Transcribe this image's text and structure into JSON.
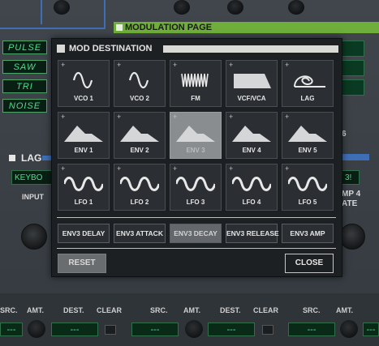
{
  "background": {
    "modulation_header": "MODULATION PAGE",
    "lfo_waves": [
      "PULSE",
      "SAW",
      "TRI",
      "NOISE"
    ],
    "lag_header": "LAG",
    "lag_field": "KEYBO",
    "lag_input_label": "INPUT",
    "right_partial_labels": [
      "6",
      "MP 4",
      "ATE"
    ],
    "right_partial_field": "3!",
    "bottom_labels": [
      "SRC.",
      "AMT.",
      "DEST.",
      "CLEAR",
      "SRC.",
      "AMT.",
      "DEST.",
      "CLEAR",
      "SRC.",
      "AMT."
    ],
    "bottom_fields": [
      "---",
      "---",
      "---",
      "---",
      "---",
      "---"
    ]
  },
  "modal": {
    "title": "MOD DESTINATION",
    "tiles": [
      {
        "label": "VCO 1",
        "icon": "sine-wave-icon"
      },
      {
        "label": "VCO 2",
        "icon": "sine-wave-icon"
      },
      {
        "label": "FM",
        "icon": "fm-wave-icon"
      },
      {
        "label": "VCF/VCA",
        "icon": "filter-shape-icon"
      },
      {
        "label": "LAG",
        "icon": "lag-curve-icon"
      },
      {
        "label": "ENV 1",
        "icon": "envelope-icon"
      },
      {
        "label": "ENV 2",
        "icon": "envelope-icon"
      },
      {
        "label": "ENV 3",
        "icon": "envelope-icon"
      },
      {
        "label": "ENV 4",
        "icon": "envelope-icon"
      },
      {
        "label": "ENV 5",
        "icon": "envelope-icon"
      },
      {
        "label": "LFO 1",
        "icon": "lfo-wave-icon"
      },
      {
        "label": "LFO 2",
        "icon": "lfo-wave-icon"
      },
      {
        "label": "LFO 3",
        "icon": "lfo-wave-icon"
      },
      {
        "label": "LFO 4",
        "icon": "lfo-wave-icon"
      },
      {
        "label": "LFO 5",
        "icon": "lfo-wave-icon"
      }
    ],
    "selected_tile": "ENV 3",
    "stages": [
      "ENV3 DELAY",
      "ENV3 ATTACK",
      "ENV3 DECAY",
      "ENV3 RELEASE",
      "ENV3 AMP"
    ],
    "selected_stage": "ENV3 DECAY",
    "reset_label": "RESET",
    "close_label": "CLOSE"
  },
  "colors": {
    "accent_green": "#6fae3b",
    "accent_blue": "#3e6fb5",
    "lcd_text": "#47e08c"
  }
}
